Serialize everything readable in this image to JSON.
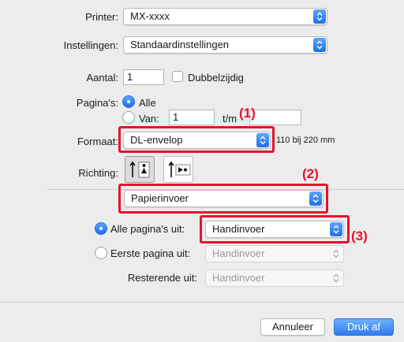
{
  "printer": {
    "label": "Printer:",
    "value": "MX-xxxx"
  },
  "presets": {
    "label": "Instellingen:",
    "value": "Standaardinstellingen"
  },
  "copies": {
    "label": "Aantal:",
    "value": "1",
    "two_sided_label": "Dubbelzijdig"
  },
  "pages": {
    "label": "Pagina's:",
    "all_label": "Alle",
    "from_label": "Van:",
    "from_value": "1",
    "to_label": "t/m",
    "to_value": ""
  },
  "paper_size": {
    "label": "Formaat:",
    "value": "DL-envelop",
    "dims": "110 bij 220 mm"
  },
  "orientation": {
    "label": "Richting:"
  },
  "section_menu": {
    "value": "Papierinvoer"
  },
  "feed": {
    "all_pages_label": "Alle pagina's uit:",
    "all_pages_value": "Handinvoer",
    "first_page_label": "Eerste pagina uit:",
    "first_page_value": "Handinvoer",
    "remaining_label": "Resterende uit:",
    "remaining_value": "Handinvoer"
  },
  "buttons": {
    "cancel": "Annuleer",
    "print": "Druk af"
  },
  "callouts": {
    "c1": "(1)",
    "c2": "(2)",
    "c3": "(3)"
  },
  "colors": {
    "accent": "#1f6fe6",
    "callout_red": "#e8112d"
  }
}
